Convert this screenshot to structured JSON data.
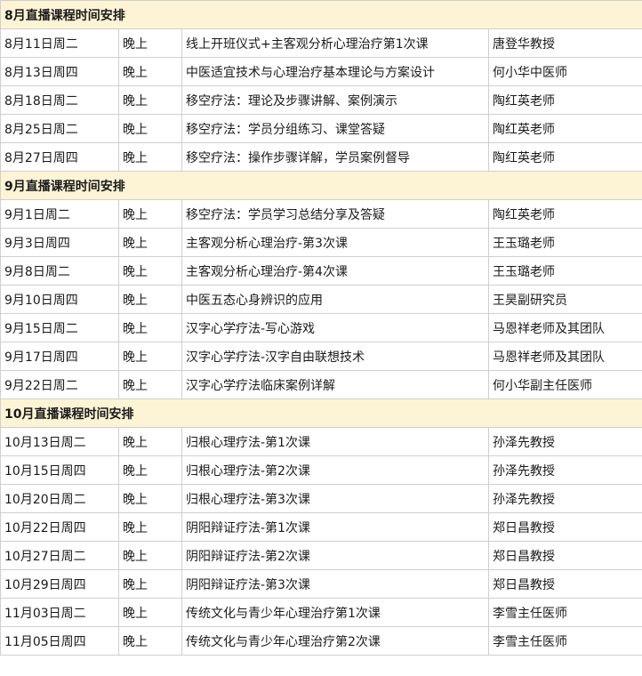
{
  "sections": [
    {
      "title": "8月直播课程时间安排",
      "rows": [
        {
          "date": "8月11日周二",
          "time": "晚上",
          "topic": "线上开班仪式+主客观分析心理治疗第1次课",
          "teacher": "唐登华教授"
        },
        {
          "date": "8月13日周四",
          "time": "晚上",
          "topic": "中医适宜技术与心理治疗基本理论与方案设计",
          "teacher": "何小华中医师"
        },
        {
          "date": "8月18日周二",
          "time": "晚上",
          "topic": "移空疗法：理论及步骤讲解、案例演示",
          "teacher": "陶红英老师"
        },
        {
          "date": "8月25日周二",
          "time": "晚上",
          "topic": "移空疗法：学员分组练习、课堂答疑",
          "teacher": "陶红英老师"
        },
        {
          "date": "8月27日周四",
          "time": "晚上",
          "topic": "移空疗法：操作步骤详解，学员案例督导",
          "teacher": "陶红英老师"
        }
      ]
    },
    {
      "title": "9月直播课程时间安排",
      "rows": [
        {
          "date": "9月1日周二",
          "time": "晚上",
          "topic": "移空疗法：学员学习总结分享及答疑",
          "teacher": "陶红英老师"
        },
        {
          "date": "9月3日周四",
          "time": "晚上",
          "topic": "主客观分析心理治疗-第3次课",
          "teacher": "王玉璐老师"
        },
        {
          "date": "9月8日周二",
          "time": "晚上",
          "topic": "主客观分析心理治疗-第4次课",
          "teacher": "王玉璐老师"
        },
        {
          "date": "9月10日周四",
          "time": "晚上",
          "topic": "中医五态心身辨识的应用",
          "teacher": "王昊副研究员"
        },
        {
          "date": "9月15日周二",
          "time": "晚上",
          "topic": "汉字心学疗法-写心游戏",
          "teacher": "马恩祥老师及其团队"
        },
        {
          "date": "9月17日周四",
          "time": "晚上",
          "topic": "汉字心学疗法-汉字自由联想技术",
          "teacher": "马恩祥老师及其团队"
        },
        {
          "date": "9月22日周二",
          "time": "晚上",
          "topic": "汉字心学疗法临床案例详解",
          "teacher": "何小华副主任医师"
        }
      ]
    },
    {
      "title": "10月直播课程时间安排",
      "rows": [
        {
          "date": "10月13日周二",
          "time": "晚上",
          "topic": "归根心理疗法-第1次课",
          "teacher": "孙泽先教授"
        },
        {
          "date": "10月15日周四",
          "time": "晚上",
          "topic": "归根心理疗法-第2次课",
          "teacher": "孙泽先教授"
        },
        {
          "date": "10月20日周二",
          "time": "晚上",
          "topic": "归根心理疗法-第3次课",
          "teacher": "孙泽先教授"
        },
        {
          "date": "10月22日周四",
          "time": "晚上",
          "topic": "阴阳辩证疗法-第1次课",
          "teacher": "郑日昌教授"
        },
        {
          "date": "10月27日周二",
          "time": "晚上",
          "topic": "阴阳辩证疗法-第2次课",
          "teacher": "郑日昌教授"
        },
        {
          "date": "10月29日周四",
          "time": "晚上",
          "topic": "阴阳辩证疗法-第3次课",
          "teacher": "郑日昌教授"
        },
        {
          "date": "11月03日周二",
          "time": "晚上",
          "topic": "传统文化与青少年心理治疗第1次课",
          "teacher": "李雪主任医师"
        },
        {
          "date": "11月05日周四",
          "time": "晚上",
          "topic": "传统文化与青少年心理治疗第2次课",
          "teacher": "李雪主任医师"
        }
      ]
    }
  ]
}
